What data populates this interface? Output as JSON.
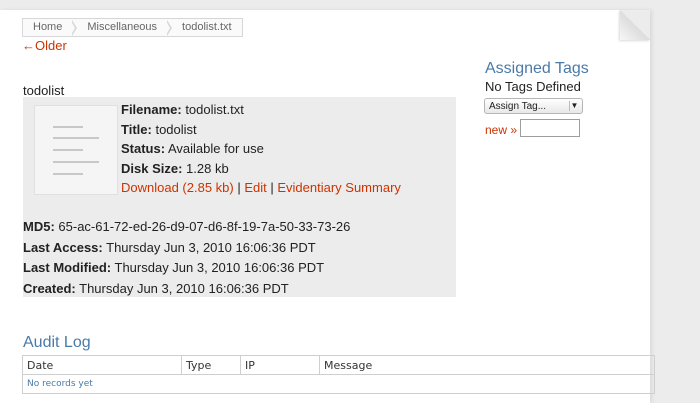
{
  "breadcrumb": [
    "Home",
    "Miscellaneous",
    "todolist.txt"
  ],
  "older_link": "←Older",
  "file": {
    "title": "todolist",
    "filename_label": "Filename:",
    "filename": "todolist.txt",
    "title_label": "Title:",
    "title_value": "todolist",
    "status_label": "Status:",
    "status": "Available for use",
    "disk_label": "Disk Size:",
    "disk_size": "1.28 kb",
    "download": "Download (2.85 kb)",
    "edit": "Edit",
    "evidentiary": "Evidentiary Summary",
    "md5_label": "MD5:",
    "md5": "65-ac-61-72-ed-26-d9-07-d6-8f-19-7a-50-33-73-26",
    "last_access_label": "Last Access:",
    "last_access": "Thursday Jun 3, 2010 16:06:36 PDT",
    "last_modified_label": "Last Modified:",
    "last_modified": "Thursday Jun 3, 2010 16:06:36 PDT",
    "created_label": "Created:",
    "created": "Thursday Jun 3, 2010 16:06:36 PDT"
  },
  "tags": {
    "title": "Assigned Tags",
    "empty": "No Tags Defined",
    "select_value": "Assign Tag...",
    "new_link": "new »"
  },
  "audit": {
    "title": "Audit Log",
    "columns": [
      "Date",
      "Type",
      "IP",
      "Message"
    ],
    "empty": "No records yet"
  },
  "colors": {
    "link": "#cc3300",
    "heading": "#4a7aa8",
    "panel": "#ececec"
  }
}
